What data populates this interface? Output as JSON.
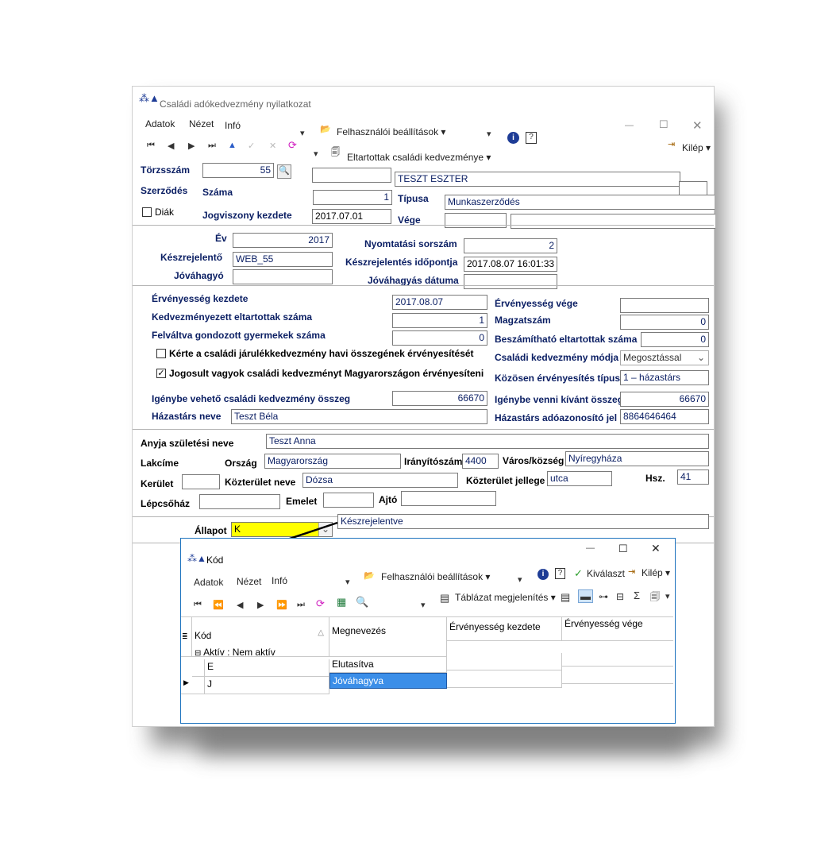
{
  "main_window": {
    "title": "Családi adókedvezmény nyilatkozat",
    "menu": [
      "Adatok",
      "Nézet",
      "Infó"
    ],
    "user_settings": "Felhasználói beállítások",
    "dependents_btn": "Eltartottak családi kedvezménye",
    "exit": "Kilép"
  },
  "header": {
    "torzsszam_label": "Törzsszám",
    "torzsszam_value": "55",
    "name_value": "TESZT ESZTER",
    "szerzodes_label": "Szerződés",
    "szama_label": "Száma",
    "szama_value": "1",
    "tipusa_label": "Típusa",
    "tipusa_value": "Munkaszerződés",
    "diak_label": "Diák",
    "jogviszony_label": "Jogviszony kezdete",
    "jogviszony_value": "2017.07.01",
    "vege_label": "Vége"
  },
  "section1": {
    "ev_label": "Év",
    "ev_value": "2017",
    "keszrejelento_label": "Készrejelentő",
    "keszrejelento_value": "WEB_55",
    "jovahagyo_label": "Jóváhagyó",
    "nyomtatasi_label": "Nyomtatási sorszám",
    "nyomtatasi_value": "2",
    "keszrejelentes_idopont_label": "Készrejelentés időpontja",
    "keszrejelentes_idopont_value": "2017.08.07 16:01:33",
    "jovahagyas_datum_label": "Jóváhagyás dátuma"
  },
  "section2": {
    "erv_kezdete_label": "Érvényesség kezdete",
    "erv_kezdete_value": "2017.08.07",
    "erv_vege_label": "Érvényesség vége",
    "eltartottak_label": "Kedvezményezett eltartottak száma",
    "eltartottak_value": "1",
    "magzatszam_label": "Magzatszám",
    "magzatszam_value": "0",
    "felvaltva_label": "Felváltva gondozott gyermekek száma",
    "felvaltva_value": "0",
    "beszamithato_label": "Beszámítható eltartottak száma",
    "beszamithato_value": "0",
    "kerte_label": "Kérte a családi járulékkedvezmény havi összegének érvényesítését",
    "modja_label": "Családi kedvezmény módja",
    "modja_value": "Megosztással",
    "jogosult_label": "Jogosult vagyok családi kedvezményt Magyarországon érvényesíteni",
    "kozosen_label": "Közösen érvényesítés típusa",
    "kozosen_value": "1 – házastárs",
    "igenybe_vehet_label": "Igénybe vehető családi kedvezmény összeg",
    "igenybe_vehet_value": "66670",
    "igenybe_venni_label": "Igénybe venni kívánt összeg",
    "igenybe_venni_value": "66670",
    "hazastars_neve_label": "Házastárs neve",
    "hazastars_neve_value": "Teszt Béla",
    "hazastars_ado_label": "Házastárs adóazonosító jel",
    "hazastars_ado_value": "8864646464"
  },
  "section3": {
    "anyja_label": "Anyja születési neve",
    "anyja_value": "Teszt Anna",
    "lakcime_label": "Lakcíme",
    "orszag_label": "Ország",
    "orszag_value": "Magyarország",
    "iranyito_label": "Irányítószám",
    "iranyito_value": "4400",
    "varos_label": "Város/község",
    "varos_value": "Nyíregyháza",
    "kerulet_label": "Kerület",
    "kozterulet_nev_label": "Közterület neve",
    "kozterulet_nev_value": "Dózsa",
    "kozterulet_jelleg_label": "Közterület jellege",
    "kozterulet_jelleg_value": "utca",
    "hsz_label": "Hsz.",
    "hsz_value": "41",
    "lepcsohaz_label": "Lépcsőház",
    "emelet_label": "Emelet",
    "ajto_label": "Ajtó"
  },
  "section4": {
    "allapot_label": "Állapot",
    "allapot_value": "K",
    "allapot_desc": "Készrejelentve"
  },
  "popup": {
    "title": "Kód",
    "menu": [
      "Adatok",
      "Nézet",
      "Infó"
    ],
    "user_settings": "Felhasználói beállítások",
    "select": "Kiválaszt",
    "exit": "Kilép",
    "table_view": "Táblázat megjelenítés",
    "columns": [
      "Kód",
      "Megnevezés",
      "Érvényesség kezdete",
      "Érvényesség vége"
    ],
    "group_label": "Aktív : Nem aktív",
    "rows": [
      {
        "kod": "E",
        "megnevezes": "Elutasítva"
      },
      {
        "kod": "J",
        "megnevezes": "Jóváhagyva"
      }
    ]
  },
  "colors": {
    "label": "#0a1e63",
    "highlight_yellow": "#ffff00",
    "selected_row": "#3b8ee8",
    "popup_border": "#1e73be"
  }
}
